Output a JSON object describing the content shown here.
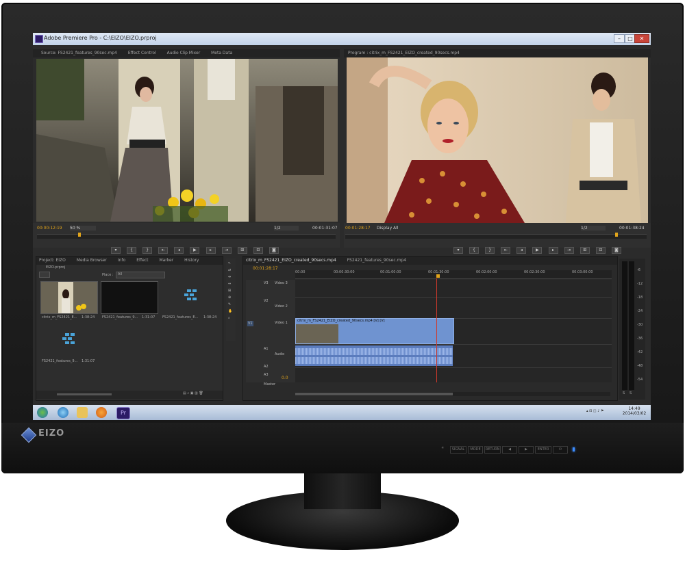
{
  "window": {
    "title": "Adobe Premiere Pro - C:\\EIZO\\EIZO.prproj",
    "min": "–",
    "max": "□",
    "close": "✕"
  },
  "source_panel": {
    "tabs": [
      "Source: FS2421_features_90sec.mp4",
      "Effect Control",
      "Audio Clip Mixer",
      "Meta Data"
    ],
    "timecode": "00:00:12:19",
    "zoom": "50 %",
    "page": "1/2",
    "duration": "00:01:31:07"
  },
  "program_panel": {
    "tab": "Program : citrix_m_FS2421_EIZO_created_90secs.mp4",
    "timecode": "00:01:28:17",
    "display": "Display All",
    "page": "1/2",
    "duration": "00:01:38:24"
  },
  "project_panel": {
    "tabs": [
      "Project: EIZO",
      "Media Browser",
      "Info",
      "Effect",
      "Marker",
      "History"
    ],
    "file": "EIZO.prproj",
    "place_label": "Place :",
    "place_value": "All",
    "items": [
      {
        "name": "citrix_m_FS2421_E...",
        "dur": "1:38:24"
      },
      {
        "name": "FS2421_features_9...",
        "dur": "1:31:07"
      },
      {
        "name": "FS2421_features_E...",
        "dur": "1:38:24"
      },
      {
        "name": "FS2421_features_9...",
        "dur": "1:31:07"
      }
    ]
  },
  "timeline": {
    "tabs": [
      "citrix_m_FS2421_EIZO_created_90secs.mp4",
      "FS2421_features_90sec.mp4"
    ],
    "timecode": "00:01:28:17",
    "ruler": [
      "00:00",
      "00:00:30:00",
      "00:01:00:00",
      "00:01:30:00",
      "00:02:00:00",
      "00:02:30:00",
      "00:03:00:00"
    ],
    "tracks": [
      {
        "id": "V3",
        "name": "Video 3"
      },
      {
        "id": "V2",
        "name": "Video 2"
      },
      {
        "id": "V1",
        "name": "Video 1"
      },
      {
        "id": "A1",
        "name": "Audio"
      },
      {
        "id": "A2",
        "name": ""
      },
      {
        "id": "A3",
        "name": ""
      }
    ],
    "clip_label": "citrix_m_FS2421_EIZO_created_90secs.mp4 [V] [V]",
    "master": "Master",
    "master_val": "0.0"
  },
  "meter_ticks": [
    "-6",
    "-12",
    "-18",
    "-24",
    "-30",
    "-36",
    "-42",
    "-48",
    "-54"
  ],
  "meter_footer": [
    "S",
    "S"
  ],
  "taskbar": {
    "time": "14:49",
    "date": "2014/03/02",
    "app": "Pr"
  },
  "monitor": {
    "brand": "EIZO",
    "buttons": [
      "SIGNAL",
      "MODE",
      "RETURN",
      "◀",
      "▶",
      "ENTER",
      "⏻"
    ]
  }
}
